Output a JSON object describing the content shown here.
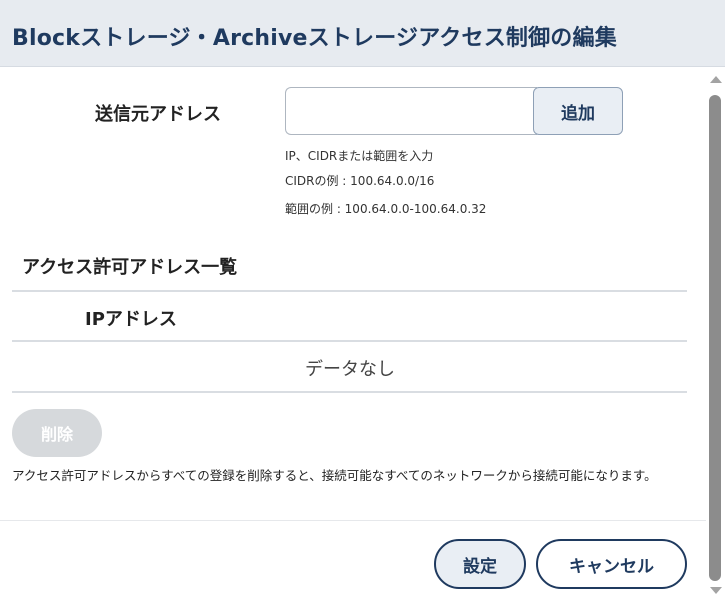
{
  "dialog": {
    "title": "Blockストレージ・Archiveストレージアクセス制御の編集"
  },
  "form": {
    "source_label": "送信元アドレス",
    "input_value": "",
    "input_placeholder": "",
    "add_label": "追加",
    "hints": [
      "IP、CIDRまたは範囲を入力",
      "CIDRの例 : 100.64.0.0/16",
      "範囲の例 : 100.64.0.0-100.64.0.32"
    ]
  },
  "allow_list": {
    "heading": "アクセス許可アドレス一覧",
    "column_header": "IPアドレス",
    "empty_text": "データなし",
    "delete_label": "削除",
    "warning": "アクセス許可アドレスからすべての登録を削除すると、接続可能なすべてのネットワークから接続可能になります。"
  },
  "footer": {
    "set_label": "設定",
    "cancel_label": "キャンセル"
  },
  "icons": {
    "scroll_up": "scroll-up-arrow-icon",
    "scroll_down": "scroll-down-arrow-icon"
  },
  "colors": {
    "header_bg": "#e7ebf0",
    "title_text": "#1f3a5f",
    "button_border": "#1f3a5f",
    "disabled_button": "#d6d9dc"
  }
}
